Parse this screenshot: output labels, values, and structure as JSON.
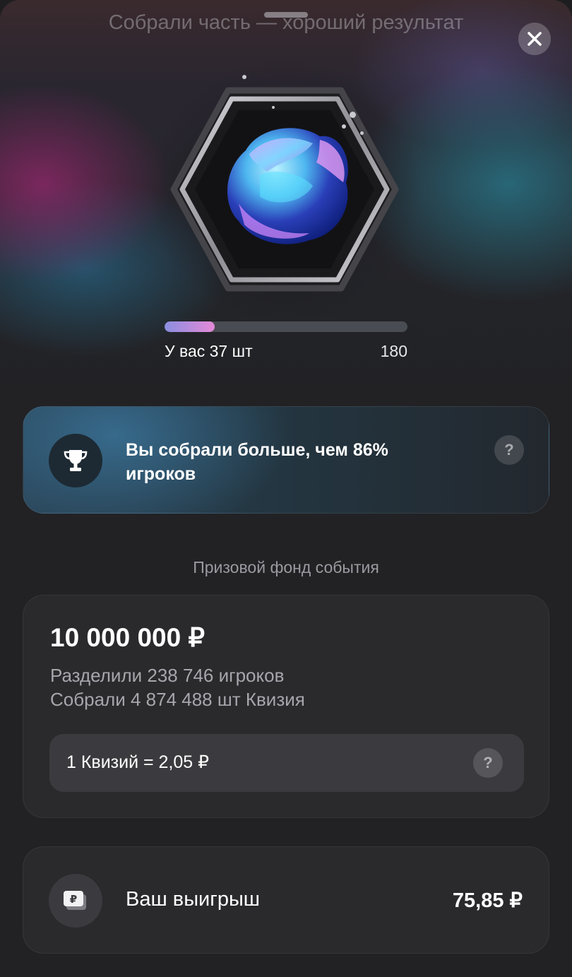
{
  "header": {
    "title": "Собрали часть — хороший результат"
  },
  "progress": {
    "collected_label": "У вас 37 шт",
    "target_label": "180",
    "collected": 37,
    "target": 180
  },
  "rank": {
    "text": "Вы собрали больше, чем 86% игроков",
    "help_label": "?"
  },
  "fund": {
    "caption": "Призовой фонд события",
    "amount": "10 000 000 ₽",
    "players_line": "Разделили 238 746 игроков",
    "collected_line": "Собрали 4 874 488 шт Квизия",
    "rate": "1 Квизий = 2,05 ₽",
    "help_label": "?"
  },
  "winnings": {
    "label": "Ваш выигрыш",
    "value": "75,85 ₽",
    "icon_glyph": "₽"
  },
  "colors": {
    "progress_start": "#8a8ee0",
    "progress_end": "#e58ad8",
    "background": "#222225",
    "card": "#2a2a2d"
  },
  "icons": {
    "close": "close-icon",
    "trophy": "trophy-icon",
    "wallet": "ruble-wallet-icon",
    "gem": "crystal-gem-icon"
  }
}
